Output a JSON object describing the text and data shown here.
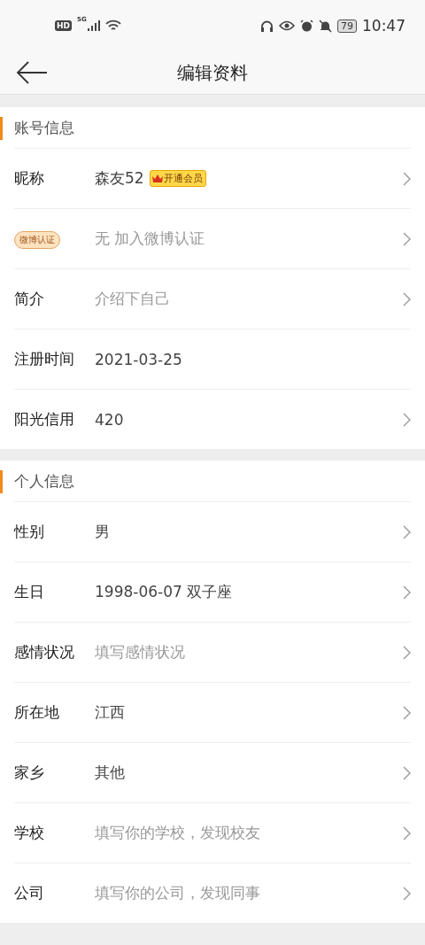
{
  "status_bar": {
    "hd": "HD",
    "network": "5G",
    "battery": "79",
    "time": "10:47"
  },
  "header": {
    "title": "编辑资料"
  },
  "sections": [
    {
      "title": "账号信息",
      "rows": [
        {
          "kind": "text",
          "label": "昵称",
          "value": "森友52",
          "muted": false,
          "badge": "开通会员",
          "chevron": true
        },
        {
          "kind": "tag",
          "label": "微博认证",
          "value": "无 加入微博认证",
          "muted": true,
          "chevron": true
        },
        {
          "kind": "text",
          "label": "简介",
          "value": "介绍下自己",
          "muted": true,
          "chevron": true
        },
        {
          "kind": "text",
          "label": "注册时间",
          "value": "2021-03-25",
          "muted": false,
          "chevron": false
        },
        {
          "kind": "text",
          "label": "阳光信用",
          "value": "420",
          "muted": false,
          "chevron": true
        }
      ]
    },
    {
      "title": "个人信息",
      "rows": [
        {
          "kind": "text",
          "label": "性别",
          "value": "男",
          "muted": false,
          "chevron": true
        },
        {
          "kind": "text",
          "label": "生日",
          "value": "1998-06-07 双子座",
          "muted": false,
          "chevron": true
        },
        {
          "kind": "text",
          "label": "感情状况",
          "value": "填写感情状况",
          "muted": true,
          "chevron": true
        },
        {
          "kind": "text",
          "label": "所在地",
          "value": "江西",
          "muted": false,
          "chevron": true
        },
        {
          "kind": "text",
          "label": "家乡",
          "value": "其他",
          "muted": false,
          "chevron": true
        },
        {
          "kind": "text",
          "label": "学校",
          "value": "填写你的学校，发现校友",
          "muted": true,
          "chevron": true
        },
        {
          "kind": "text",
          "label": "公司",
          "value": "填写你的公司，发现同事",
          "muted": true,
          "chevron": true
        }
      ]
    }
  ]
}
